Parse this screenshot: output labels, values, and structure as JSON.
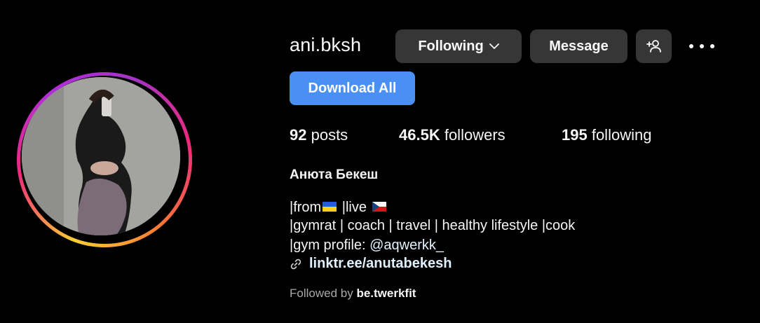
{
  "profile": {
    "username": "ani.bksh",
    "full_name": "Анюта Бекеш",
    "following_button": "Following",
    "message_button": "Message",
    "download_button": "Download All",
    "stats": {
      "posts_count": "92",
      "posts_label": " posts",
      "followers_count": "46.5K",
      "followers_label": " followers",
      "following_count": "195",
      "following_label": " following"
    },
    "bio": {
      "line1_a": "|from",
      "line1_b": " |live ",
      "line2": "|gymrat | coach | travel | healthy lifestyle |cook",
      "line3_a": "|gym profile: ",
      "line3_mention": "@aqwerkk_",
      "link": "linktr.ee/anutabekesh"
    },
    "followed_by_label": "Followed by ",
    "followed_by_user": "be.twerkfit"
  },
  "colors": {
    "background": "#000000",
    "button": "#363636",
    "primary": "#4a90f2",
    "link": "#e0f1ff"
  },
  "icons": [
    "chevron-down-icon",
    "add-user-icon",
    "more-icon",
    "link-icon",
    "ukraine-flag-icon",
    "czech-flag-icon"
  ]
}
